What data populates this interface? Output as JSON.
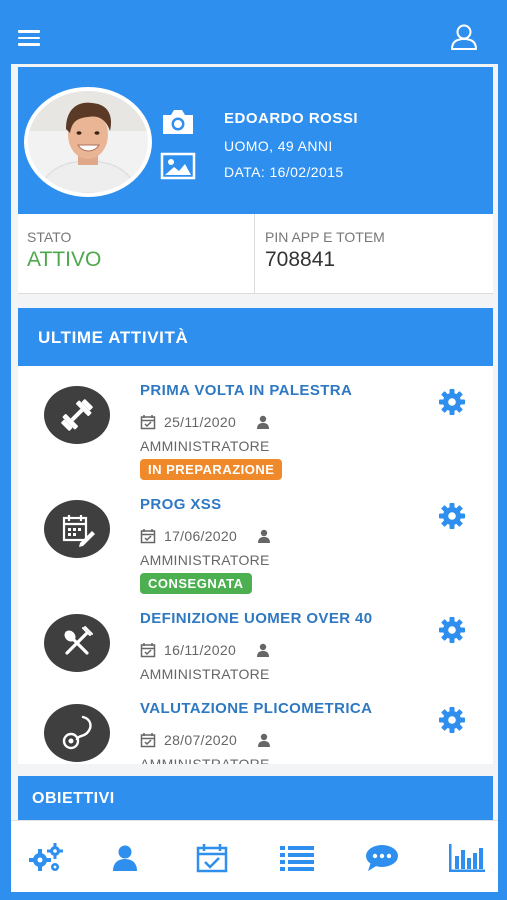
{
  "topbar": {
    "menu_icon": "hamburger-menu-icon",
    "user_icon": "user-outline-icon"
  },
  "profile": {
    "name": "EDOARDO ROSSI",
    "subtitle": "UOMO, 49 ANNI",
    "date": "DATA: 16/02/2015",
    "camera_icon": "camera-icon",
    "image_icon": "image-icon"
  },
  "info": {
    "stato_label": "STATO",
    "stato_value": "ATTIVO",
    "pin_label": "PIN APP E TOTEM",
    "pin_value": "708841"
  },
  "activities": {
    "header": "ULTIME ATTIVITÀ",
    "items": [
      {
        "title": "PRIMA VOLTA IN PALESTRA",
        "date": "25/11/2020",
        "user": "AMMINISTRATORE",
        "badge": "IN PREPARAZIONE",
        "badge_color": "#f0892a",
        "icon": "dumbbell-icon"
      },
      {
        "title": "PROG XSS",
        "date": "17/06/2020",
        "user": "AMMINISTRATORE",
        "badge": "CONSEGNATA",
        "badge_color": "#4caf50",
        "icon": "calendar-edit-icon"
      },
      {
        "title": "DEFINIZIONE UOMER OVER 40",
        "date": "16/11/2020",
        "user": "AMMINISTRATORE",
        "icon": "fork-spoon-icon"
      },
      {
        "title": "VALUTAZIONE PLICOMETRICA",
        "date": "28/07/2020",
        "user": "AMMINISTRATORE",
        "icon": "stethoscope-icon"
      }
    ]
  },
  "objectives": {
    "header": "OBIETTIVI"
  },
  "bottom_nav": [
    "gears-icon",
    "user-icon",
    "calendar-check-icon",
    "list-icon",
    "chat-icon",
    "bar-chart-icon"
  ],
  "colors": {
    "primary": "#2f8fef",
    "link": "#2f78c2",
    "active_green": "#4ea84e"
  }
}
